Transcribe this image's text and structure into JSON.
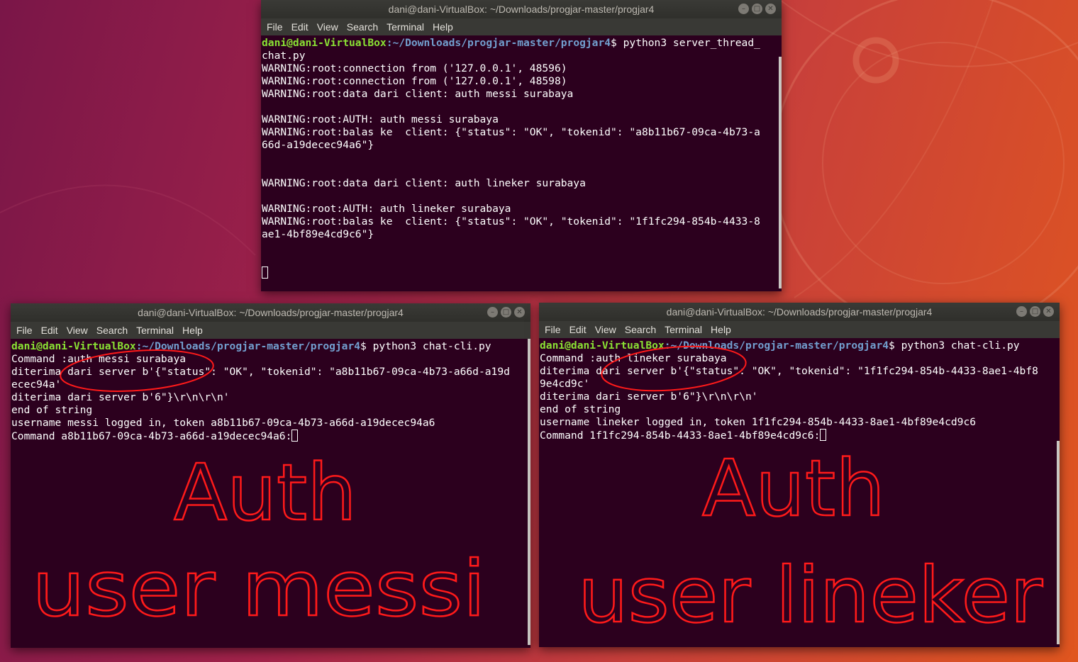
{
  "server_window": {
    "title": "dani@dani-VirtualBox: ~/Downloads/progjar-master/progjar4",
    "menu": [
      "File",
      "Edit",
      "View",
      "Search",
      "Terminal",
      "Help"
    ],
    "prompt_user": "dani@dani-VirtualBox",
    "prompt_path": ":~/Downloads/progjar-master/progjar4",
    "prompt_cmd": "$ python3 server_thread_",
    "lines": [
      "chat.py",
      "WARNING:root:connection from ('127.0.0.1', 48596)",
      "WARNING:root:connection from ('127.0.0.1', 48598)",
      "WARNING:root:data dari client: auth messi surabaya",
      "",
      "WARNING:root:AUTH: auth messi surabaya",
      "WARNING:root:balas ke  client: {\"status\": \"OK\", \"tokenid\": \"a8b11b67-09ca-4b73-a",
      "66d-a19decec94a6\"}",
      "",
      "",
      "WARNING:root:data dari client: auth lineker surabaya",
      "",
      "WARNING:root:AUTH: auth lineker surabaya",
      "WARNING:root:balas ke  client: {\"status\": \"OK\", \"tokenid\": \"1f1fc294-854b-4433-8",
      "ae1-4bf89e4cd9c6\"}"
    ]
  },
  "client_messi": {
    "title": "dani@dani-VirtualBox: ~/Downloads/progjar-master/progjar4",
    "menu": [
      "File",
      "Edit",
      "View",
      "Search",
      "Terminal",
      "Help"
    ],
    "prompt_user": "dani@dani-VirtualBox",
    "prompt_path": ":~/Downloads/progjar-master/progjar4",
    "prompt_cmd": "$ python3 chat-cli.py",
    "lines": [
      "Command :auth messi surabaya",
      "diterima dari server b'{\"status\": \"OK\", \"tokenid\": \"a8b11b67-09ca-4b73-a66d-a19d",
      "ecec94a'",
      "diterima dari server b'6\"}\\r\\n\\r\\n'",
      "end of string",
      "username messi logged in, token a8b11b67-09ca-4b73-a66d-a19decec94a6"
    ],
    "last_line": "Command a8b11b67-09ca-4b73-a66d-a19decec94a6:",
    "annotation_line1": "Auth",
    "annotation_line2": "user messi"
  },
  "client_lineker": {
    "title": "dani@dani-VirtualBox: ~/Downloads/progjar-master/progjar4",
    "menu": [
      "File",
      "Edit",
      "View",
      "Search",
      "Terminal",
      "Help"
    ],
    "prompt_user": "dani@dani-VirtualBox",
    "prompt_path": ":~/Downloads/progjar-master/progjar4",
    "prompt_cmd": "$ python3 chat-cli.py",
    "lines": [
      "Command :auth lineker surabaya",
      "diterima dari server b'{\"status\": \"OK\", \"tokenid\": \"1f1fc294-854b-4433-8ae1-4bf8",
      "9e4cd9c'",
      "diterima dari server b'6\"}\\r\\n\\r\\n'",
      "end of string",
      "username lineker logged in, token 1f1fc294-854b-4433-8ae1-4bf89e4cd9c6"
    ],
    "last_line": "Command 1f1fc294-854b-4433-8ae1-4bf89e4cd9c6:",
    "annotation_line1": "Auth",
    "annotation_line2": "user lineker"
  },
  "colors": {
    "terminal_bg": "#2c001e",
    "prompt_user": "#8ae234",
    "prompt_path": "#729fcf",
    "annotation": "#ff1a1a"
  }
}
